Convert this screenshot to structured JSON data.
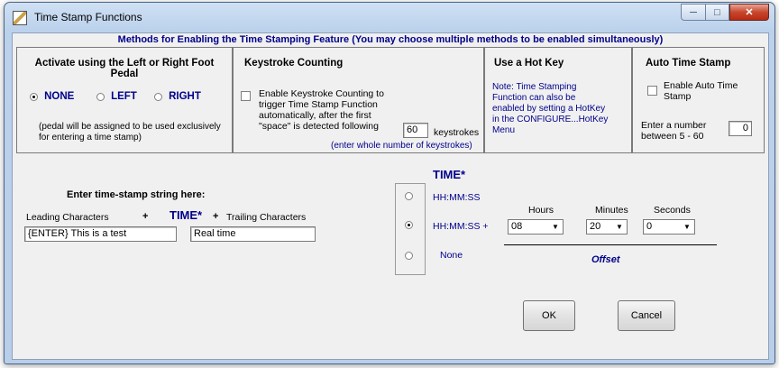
{
  "window": {
    "title": "Time Stamp Functions"
  },
  "methods_header": "Methods for Enabling the Time Stamping Feature (You may choose multiple methods to be enabled simultaneously)",
  "foot_pedal": {
    "title": "Activate using the Left or Right Foot Pedal",
    "options": [
      "NONE",
      "LEFT",
      "RIGHT"
    ],
    "selected": "NONE",
    "note": "(pedal will be assigned to be used exclusively for entering a time stamp)"
  },
  "keystroke": {
    "title": "Keystroke Counting",
    "checkbox_label": "Enable Keystroke Counting to trigger Time Stamp Function automatically, after the first \"space\" is detected following",
    "count_value": "60",
    "count_suffix": "keystrokes",
    "hint": "(enter whole number of keystrokes)"
  },
  "hotkey": {
    "title": "Use a Hot Key",
    "note": "Note: Time Stamping Function can also be enabled by setting a HotKey in the CONFIGURE...HotKey Menu"
  },
  "auto_stamp": {
    "title": "Auto Time Stamp",
    "checkbox_label": "Enable Auto Time Stamp",
    "range_label": "Enter a number between 5 - 60",
    "value": "0"
  },
  "stamp_string": {
    "heading": "Enter time-stamp string here:",
    "leading_label": "Leading Characters",
    "plus": "+",
    "time_token": "TIME*",
    "trailing_label": "Trailing Characters",
    "leading_value": "{ENTER} This is a test",
    "trailing_value": "Real time"
  },
  "time_format": {
    "header": "TIME*",
    "options": [
      "HH:MM:SS",
      "HH:MM:SS  +",
      "None"
    ],
    "selected_index": 1
  },
  "offset": {
    "hours_label": "Hours",
    "minutes_label": "Minutes",
    "seconds_label": "Seconds",
    "hours_value": "08",
    "minutes_value": "20",
    "seconds_value": "0",
    "caption": "Offset"
  },
  "buttons": {
    "ok": "OK",
    "cancel": "Cancel"
  },
  "icons": {
    "minimize": "minimize-icon",
    "maximize": "maximize-icon",
    "close": "close-icon",
    "app": "app-icon",
    "dropdown": "chevron-down-icon"
  }
}
